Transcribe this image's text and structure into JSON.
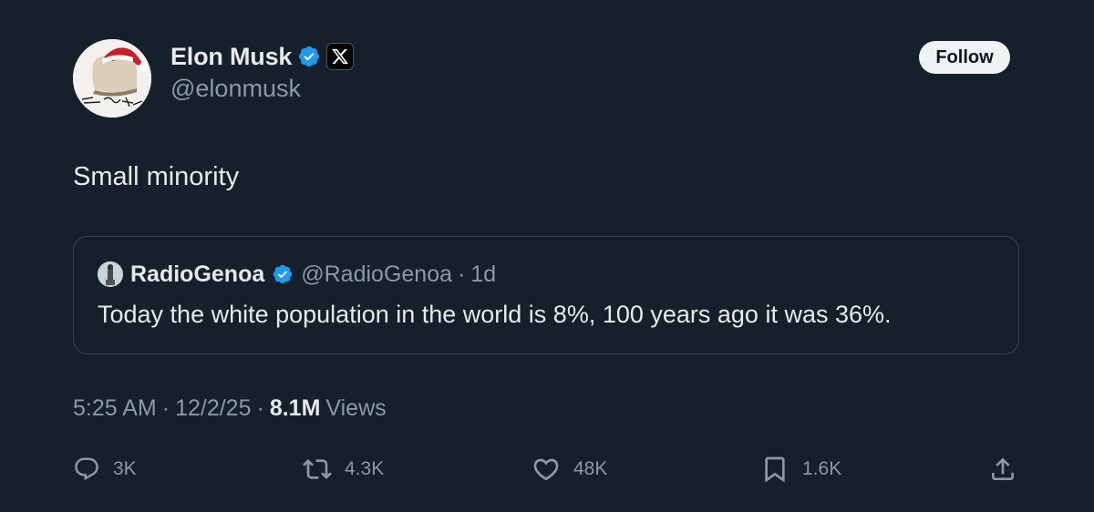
{
  "author": {
    "display_name": "Elon Musk",
    "handle": "@elonmusk",
    "verified_color": "#1d9bf0",
    "affiliate_badge_icon": "x-logo-icon"
  },
  "follow_button": {
    "label": "Follow"
  },
  "tweet": {
    "text": "Small minority"
  },
  "quote": {
    "display_name": "RadioGenoa",
    "handle": "@RadioGenoa",
    "separator": "·",
    "time": "1d",
    "text": "Today the white population in the world is 8%, 100 years ago it was 36%."
  },
  "meta": {
    "time": "5:25 AM",
    "sep1": "·",
    "date": "12/2/25",
    "sep2": "·",
    "views_count": "8.1M",
    "views_label": "Views"
  },
  "actions": {
    "replies": {
      "icon": "reply-icon",
      "count": "3K"
    },
    "reposts": {
      "icon": "repost-icon",
      "count": "4.3K"
    },
    "likes": {
      "icon": "heart-icon",
      "count": "48K"
    },
    "bookmarks": {
      "icon": "bookmark-icon",
      "count": "1.6K"
    },
    "share": {
      "icon": "share-icon"
    }
  },
  "colors": {
    "background": "#15202b",
    "primary_text": "#e7e9ea",
    "secondary_text": "#8b98a5",
    "border": "#38444d",
    "verified_blue": "#1d9bf0"
  }
}
